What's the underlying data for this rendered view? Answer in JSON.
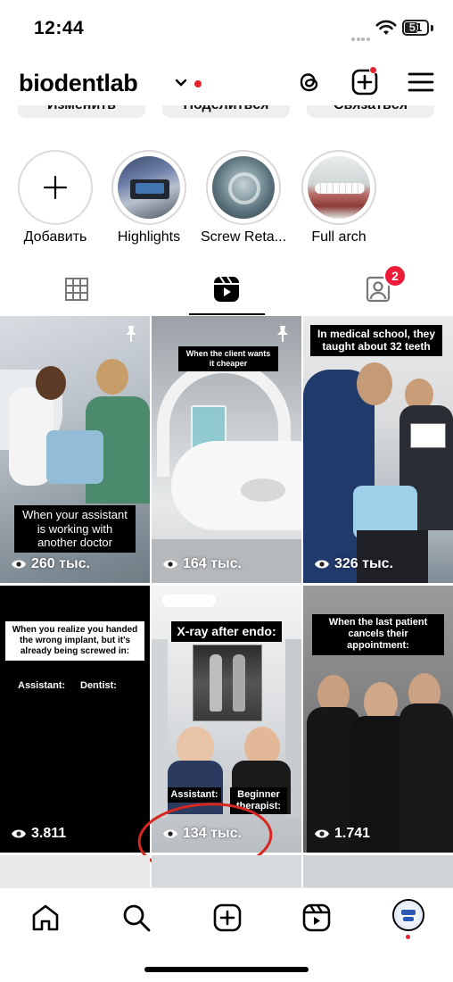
{
  "status_bar": {
    "time": "12:44",
    "battery": "51"
  },
  "header": {
    "username": "biodentlab"
  },
  "profile_actions": [
    "Изменить",
    "Поделиться",
    "Связаться"
  ],
  "highlights": [
    {
      "label": "Добавить"
    },
    {
      "label": "Highlights"
    },
    {
      "label": "Screw Reta..."
    },
    {
      "label": "Full arch"
    }
  ],
  "tabs": {
    "tagged_badge": "2",
    "active": "reels"
  },
  "reels": [
    {
      "caption": "When your assistant is working with another doctor",
      "views": "260 тыс.",
      "pinned": true
    },
    {
      "caption": "When the client wants it cheaper",
      "views": "164 тыс.",
      "pinned": true
    },
    {
      "caption": "In medical school, they taught about 32 teeth",
      "views": "326 тыс.",
      "pinned": true
    },
    {
      "caption": "When you realize you handed the wrong implant, but it's already being screwed in:",
      "label_left": "Assistant:",
      "label_right": "Dentist:",
      "views": "3.811"
    },
    {
      "caption": "X-ray after endo:",
      "label_left": "Assistant:",
      "label_right": "Beginner therapist:",
      "views": "134 тыс."
    },
    {
      "caption": "When the last patient cancels their appointment:",
      "views": "1.741"
    }
  ],
  "highlight_ring_color": "#e5232f",
  "accent_colors": {
    "red_dot": "#e5232f",
    "badge": "#ee1c3a"
  }
}
